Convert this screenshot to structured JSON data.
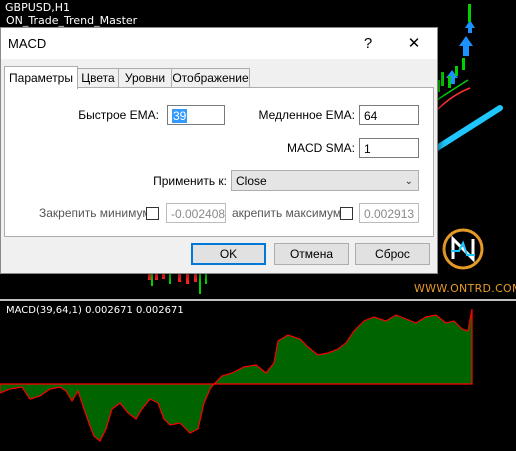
{
  "chart": {
    "symbol_label": "GBPUSD,H1",
    "indicator_label": "ON_Trade_Trend_Master",
    "macd_label": "MACD(39,64,1) 0.002671 0.002671",
    "watermark": "WWW.ONTRD.COM",
    "colors": {
      "macd_fill": "#006400",
      "macd_line": "#ff0000",
      "bull_arrow": "#1e90ff",
      "trend_line": "#1ec8ff",
      "bull_candle": "#00d000",
      "bear_candle": "#ff2020",
      "zero_line": "#808080"
    }
  },
  "dialog": {
    "title": "MACD",
    "help_button": "?",
    "close_button": "✕",
    "tabs": [
      {
        "label": "Параметры",
        "active": true
      },
      {
        "label": "Цвета",
        "active": false
      },
      {
        "label": "Уровни",
        "active": false
      },
      {
        "label": "Отображение",
        "active": false
      }
    ],
    "params": {
      "fast_ema_label": "Быстрое EMA:",
      "fast_ema_value": "39",
      "slow_ema_label": "Медленное EMA:",
      "slow_ema_value": "64",
      "macd_sma_label": "MACD SMA:",
      "macd_sma_value": "1",
      "apply_to_label": "Применить к:",
      "apply_to_value": "Close",
      "fix_min_label": "Закрепить минимум",
      "fix_min_value": "-0.002408",
      "fix_max_label": "акрепить максимум",
      "fix_max_value": "0.002913"
    },
    "buttons": {
      "ok": "OK",
      "cancel": "Отмена",
      "reset": "Сброс"
    }
  }
}
